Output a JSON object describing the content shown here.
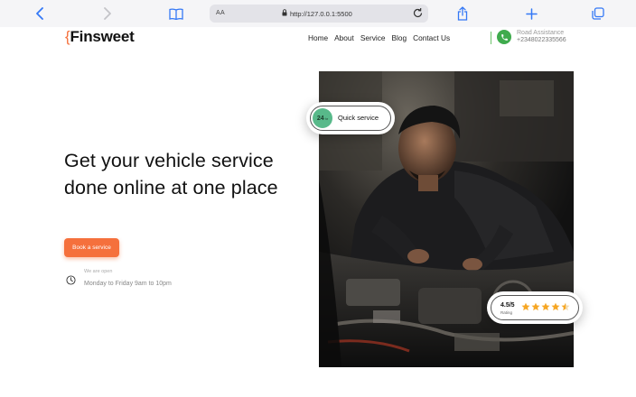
{
  "browser": {
    "text_size_label": "AA",
    "url": "http://127.0.0.1:5500"
  },
  "header": {
    "logo_brace": "{",
    "logo_text": "Finsweet",
    "nav": [
      "Home",
      "About",
      "Service",
      "Blog",
      "Contact Us"
    ],
    "road_assistance_label": "Road Assistance",
    "road_assistance_phone": "+2348022335566"
  },
  "hero": {
    "heading": "Get your vehicle service done online at one place",
    "book_button": "Book a service",
    "open_label": "We are open",
    "open_hours": "Monday to Friday 9am to 10pm",
    "image_icon": "mechanic-photo"
  },
  "quick_service": {
    "badge_number": "24",
    "badge_unit": "hr",
    "label": "Quick service"
  },
  "rating": {
    "value": "4.5/5",
    "label": "Rating",
    "stars": 4.5,
    "max_stars": 5
  },
  "colors": {
    "accent": "#f5703c",
    "green": "#3fab4d",
    "badge": "#58b98a",
    "star": "#f6a623",
    "safari_blue": "#3478f6"
  }
}
